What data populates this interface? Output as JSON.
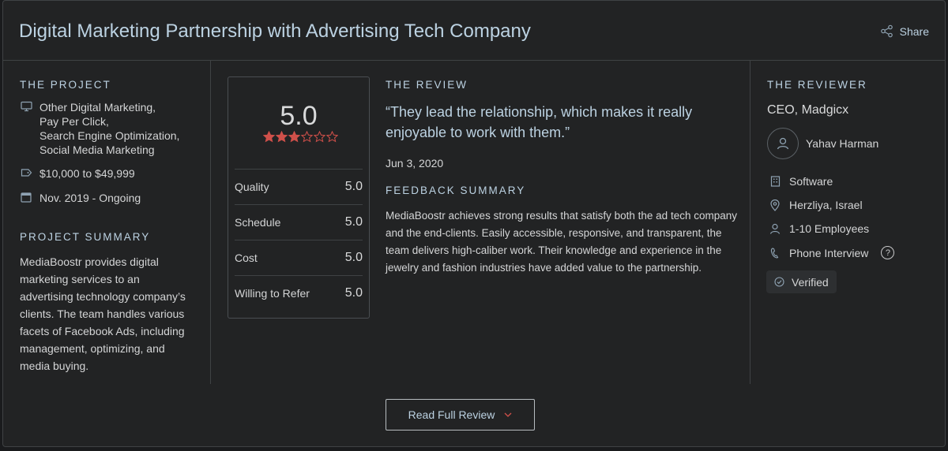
{
  "header": {
    "title": "Digital Marketing Partnership with Advertising Tech Company",
    "share_label": "Share"
  },
  "project": {
    "heading": "THE PROJECT",
    "services": [
      "Other Digital Marketing,",
      "Pay Per Click,",
      "Search Engine Optimization,",
      "Social Media Marketing"
    ],
    "budget": "$10,000 to $49,999",
    "timeline": "Nov. 2019 - Ongoing",
    "summary_heading": "PROJECT SUMMARY",
    "summary": "MediaBoostr provides digital marketing services to an advertising technology company’s clients. The team handles various facets of Facebook Ads, including management, optimizing, and media buying."
  },
  "rating": {
    "overall": "5.0",
    "stars_filled": 3,
    "stars_total": 6,
    "rows": [
      {
        "label": "Quality",
        "value": "5.0"
      },
      {
        "label": "Schedule",
        "value": "5.0"
      },
      {
        "label": "Cost",
        "value": "5.0"
      },
      {
        "label": "Willing to Refer",
        "value": "5.0"
      }
    ]
  },
  "review": {
    "heading": "THE REVIEW",
    "quote": "“They lead the relationship, which makes it really enjoyable to work with them.”",
    "date": "Jun 3, 2020",
    "feedback_heading": "FEEDBACK SUMMARY",
    "feedback": "MediaBoostr achieves strong results that satisfy both the ad tech company and the end-clients. Easily accessible, responsive, and transparent, the team delivers high-caliber work. Their knowledge and experience in the jewelry and fashion industries have added value to the partnership."
  },
  "reviewer": {
    "heading": "THE REVIEWER",
    "title": "CEO, Madgicx",
    "name": "Yahav Harman",
    "industry": "Software",
    "location": "Herzliya, Israel",
    "size": "1-10 Employees",
    "method": "Phone Interview",
    "method_help": "?",
    "verified": "Verified"
  },
  "footer": {
    "read_label": "Read Full Review"
  },
  "colors": {
    "accent": "#bcd2e2",
    "star": "#d0504a",
    "background": "#222324"
  }
}
